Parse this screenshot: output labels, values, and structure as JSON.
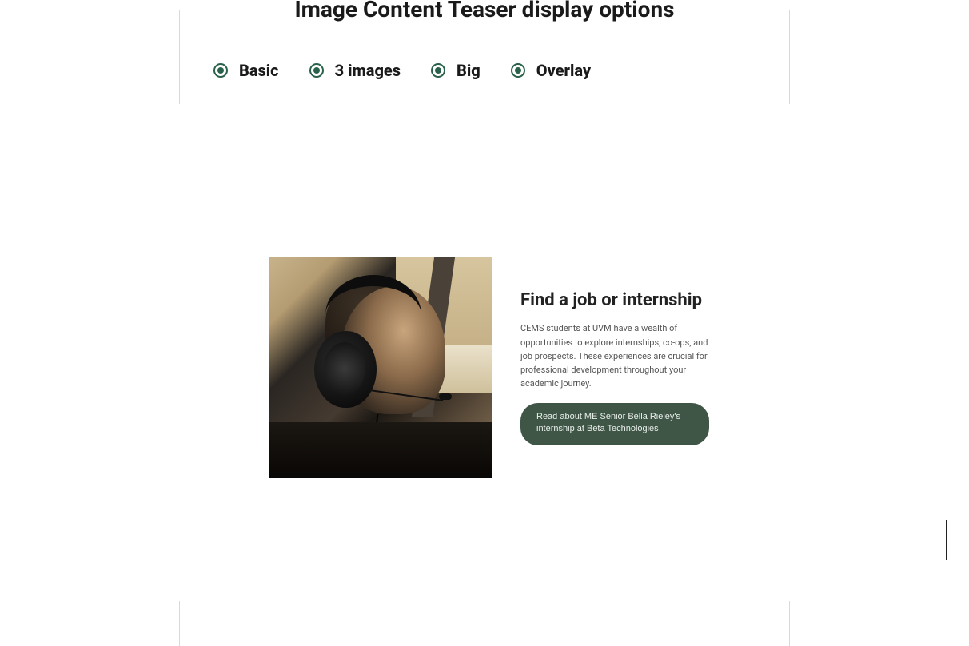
{
  "header": {
    "title": "Image Content Teaser display options"
  },
  "options": [
    {
      "key": "basic",
      "label": "Basic"
    },
    {
      "key": "3-images",
      "label": "3 images"
    },
    {
      "key": "big",
      "label": "Big"
    },
    {
      "key": "overlay",
      "label": "Overlay"
    }
  ],
  "teaser": {
    "image_alt": "pilot-headset-photo",
    "title": "Find a job or internship",
    "description": "CEMS students at UVM have a wealth of opportunities to explore internships, co-ops, and job prospects. These experiences are crucial for professional development throughout your academic journey.",
    "button_label": "Read about ME Senior Bella Rieley's internship at Beta Technologies"
  },
  "colors": {
    "accent_green": "#2a614a",
    "button_bg": "#3f5647"
  }
}
